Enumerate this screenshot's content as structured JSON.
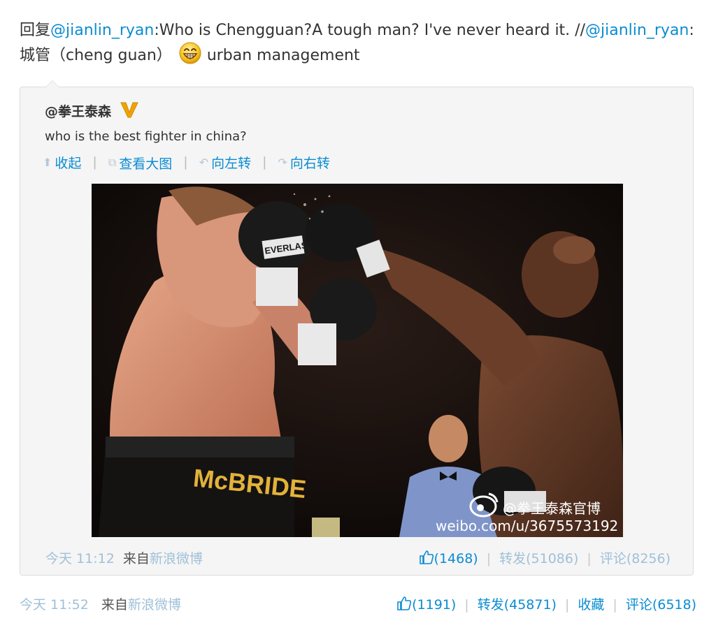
{
  "post": {
    "reply_prefix": "回复",
    "mention_1": "@jianlin_ryan",
    "text_1": ":Who is Chengguan?A tough man? I've never heard it. //",
    "mention_2": "@jianlin_ryan",
    "text_2": ":",
    "line2_text": "城管（cheng guan）",
    "emoji": "grinning-face-emoji",
    "line2_tail": "urban management",
    "time": "今天 11:52",
    "from_label": "来自",
    "source": "新浪微博",
    "likes": "(1191)",
    "repost_label": "转发(45871)",
    "favorite_label": "收藏",
    "comment_label": "评论(6518)"
  },
  "quoted": {
    "author": "@拳王泰森",
    "verified_badge": "V",
    "text": "who is the best fighter in china?",
    "tools": {
      "collapse": "收起",
      "view_large": "查看大图",
      "rotate_left": "向左转",
      "rotate_right": "向右转"
    },
    "image": {
      "trunks_text": "McBRIDE",
      "glove_brand": "EVERLAST",
      "watermark_name": "@拳王泰森官博",
      "watermark_url": "weibo.com/u/3675573192"
    },
    "time": "今天 11:12",
    "from_label": "来自",
    "source": "新浪微博",
    "likes": "(1468)",
    "repost_label": "转发(51086)",
    "comment_label": "评论(8256)"
  },
  "colors": {
    "link": "#0a8cd2",
    "muted_link": "#9fc0d8",
    "quote_bg": "#f5f5f5",
    "verified": "#f0a400"
  }
}
